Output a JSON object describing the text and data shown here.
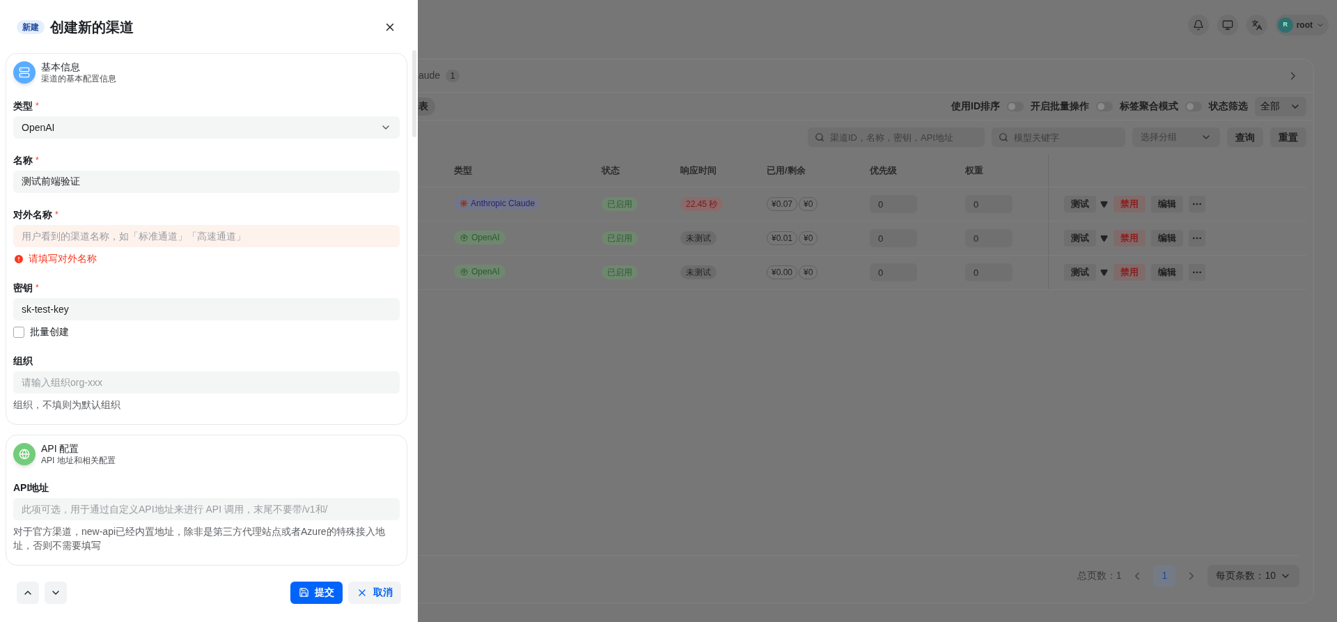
{
  "drawer": {
    "badge": "新建",
    "title": "创建新的渠道",
    "sections": [
      {
        "kind": "server",
        "color": "#5aacff",
        "title": "基本信息",
        "subtitle": "渠道的基本配置信息",
        "fields": [
          {
            "kind": "select",
            "label": "类型",
            "required_mark": "*",
            "value": "OpenAI"
          },
          {
            "kind": "input",
            "label": "名称",
            "required_mark": "*",
            "value": "测试前端验证"
          },
          {
            "kind": "input",
            "label": "对外名称",
            "required_mark": "*",
            "placeholder": "用户看到的渠道名称，如「标准通道」「高速通道」",
            "error": "请填写对外名称"
          },
          {
            "kind": "input",
            "label": "密钥",
            "required_mark": "*",
            "value": "sk-test-key",
            "checkbox": {
              "label": "批量创建",
              "checked": false
            }
          },
          {
            "kind": "input",
            "label": "组织",
            "placeholder": "请输入组织org-xxx",
            "help": "组织，不填则为默认组织"
          }
        ]
      },
      {
        "kind": "globe",
        "color": "#72cc7a",
        "title": "API 配置",
        "subtitle": "API 地址和相关配置",
        "fields": [
          {
            "kind": "input",
            "label": "API地址",
            "placeholder": "此项可选，用于通过自定义API地址来进行 API 调用，末尾不要带/v1和/",
            "help": "对于官方渠道，new-api已经内置地址，除非是第三方代理站点或者Azure的特殊接入地址，否则不需要填写"
          }
        ]
      }
    ],
    "footer": {
      "submit": "提交",
      "cancel": "取消"
    }
  },
  "page": {
    "user": {
      "avatar": "R",
      "name": "root"
    },
    "tabs": [
      {
        "label": "aude",
        "count": "1"
      }
    ],
    "view_button": "表",
    "toggles": [
      {
        "label": "使用ID排序",
        "on": false
      },
      {
        "label": "开启批量操作",
        "on": false
      },
      {
        "label": "标签聚合模式",
        "on": false
      }
    ],
    "status_filter": {
      "label": "状态筛选",
      "value": "全部"
    },
    "search": [
      {
        "placeholder": "渠道ID，名称，密钥，API地址"
      },
      {
        "placeholder": "模型关键字"
      }
    ],
    "group_select": {
      "placeholder": "选择分组"
    },
    "query_button": "查询",
    "reset_button": "重置",
    "table": {
      "columns": [
        "类型",
        "状态",
        "响应时间",
        "已用/剩余",
        "优先级",
        "权重"
      ],
      "rows": [
        {
          "type": {
            "kind": "anthropic",
            "label": "Anthropic Claude"
          },
          "status": "已启用",
          "response": {
            "kind": "slow",
            "label": "22.45 秒"
          },
          "used": "¥0.07",
          "remaining": "¥0",
          "priority": "0",
          "weight": "0",
          "actions": [
            {
              "kind": "test",
              "label": "测试"
            },
            {
              "kind": "disable",
              "label": "禁用"
            },
            {
              "kind": "edit",
              "label": "编辑"
            }
          ]
        },
        {
          "type": {
            "kind": "openai",
            "label": "OpenAI"
          },
          "status": "已启用",
          "response": {
            "kind": "untested",
            "label": "未测试"
          },
          "used": "¥0.01",
          "remaining": "¥0",
          "priority": "0",
          "weight": "0",
          "actions": [
            {
              "kind": "test",
              "label": "测试"
            },
            {
              "kind": "disable",
              "label": "禁用"
            },
            {
              "kind": "edit",
              "label": "编辑"
            }
          ]
        },
        {
          "type": {
            "kind": "openai",
            "label": "OpenAI"
          },
          "status": "已启用",
          "response": {
            "kind": "untested",
            "label": "未测试"
          },
          "used": "¥0.00",
          "remaining": "¥0",
          "priority": "0",
          "weight": "0",
          "actions": [
            {
              "kind": "test",
              "label": "测试"
            },
            {
              "kind": "disable",
              "label": "禁用"
            },
            {
              "kind": "edit",
              "label": "编辑"
            }
          ]
        }
      ]
    },
    "pagination": {
      "total": "总页数：1",
      "pages": [
        {
          "label": "1",
          "selected": true
        }
      ],
      "page_size": "每页条数：10"
    }
  }
}
